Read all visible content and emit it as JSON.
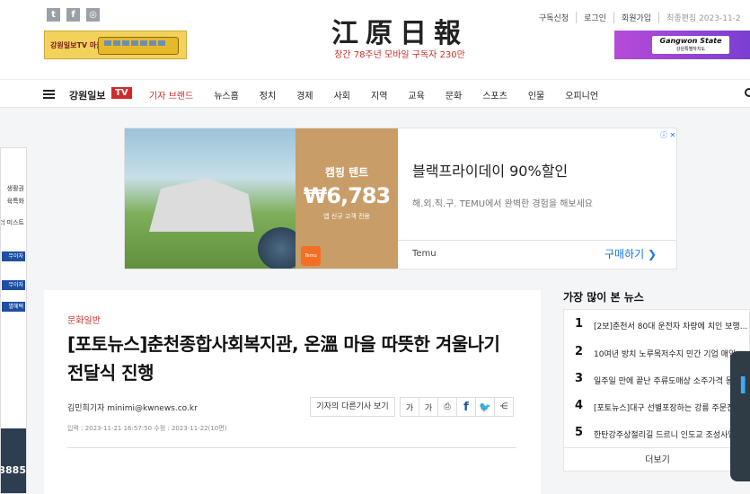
{
  "header": {
    "logo": "江原日報",
    "tagline": "창간 78주년 모바일 구독자 230만",
    "util_links": [
      "구독신청",
      "로그인",
      "회원가입"
    ],
    "updated": "최종편집 2023-11-2",
    "social_icons": [
      "twitter-icon",
      "facebook-icon",
      "instagram-icon"
    ],
    "left_ad_text": "강원일보TV 마을버스",
    "right_ad_text": "Gangwon State",
    "right_ad_sub": "강원특별자치도"
  },
  "nav": {
    "brand": "강원일보",
    "tv": "TV",
    "items": [
      "기자 브랜드",
      "뉴스홈",
      "정치",
      "경제",
      "사회",
      "지역",
      "교육",
      "문화",
      "스포츠",
      "인물",
      "오피니언"
    ]
  },
  "side_ad": {
    "lines": [
      "생활권",
      "육특화",
      "별 더 미스트"
    ],
    "tags": [
      "무이자",
      "무이자",
      "별혜택"
    ],
    "number": "3885"
  },
  "banner": {
    "promo_title": "캠핑 텐트",
    "price": "₩6,783",
    "promo_note": "앱 신규 고객 전용",
    "headline": "블랙프라이데이 90%할인",
    "description": "해.외.직.구. TEMU에서 완벽한 경험을 해보세요",
    "brand": "Temu",
    "cta": "구매하기 ❯",
    "ad_icon": "ⓘ ✕"
  },
  "article": {
    "category": "문화일반",
    "headline": "[포토뉴스]춘천종합사회복지관, 온溫 마을 따뜻한 겨울나기 전달식 진행",
    "byline": "김민희기자 minimi@kwnews.co.kr",
    "other_articles": "기자의 다른기사 보기",
    "font_down": "가",
    "font_up": "가",
    "dates": "입력 : 2023-11-21 16:57:50 수정 : 2023-11-22(10면)"
  },
  "popular": {
    "title": "가장 많이 본 뉴스",
    "items": [
      {
        "rank": "1",
        "title": "[2보]춘천서 80대 운전자 차량에 치인 보행..."
      },
      {
        "rank": "2",
        "title": "10여년 방치 노루목저수지 민간 기업 매입..."
      },
      {
        "rank": "3",
        "title": "일주일 만에 끝난 주류도매상 소주가격 동결"
      },
      {
        "rank": "4",
        "title": "[포토뉴스]대구 선별포장하는 강릉 주문진"
      },
      {
        "rank": "5",
        "title": "한탄강주상절리길 드르니 인도교 조성사업"
      }
    ],
    "more": "더보기"
  }
}
